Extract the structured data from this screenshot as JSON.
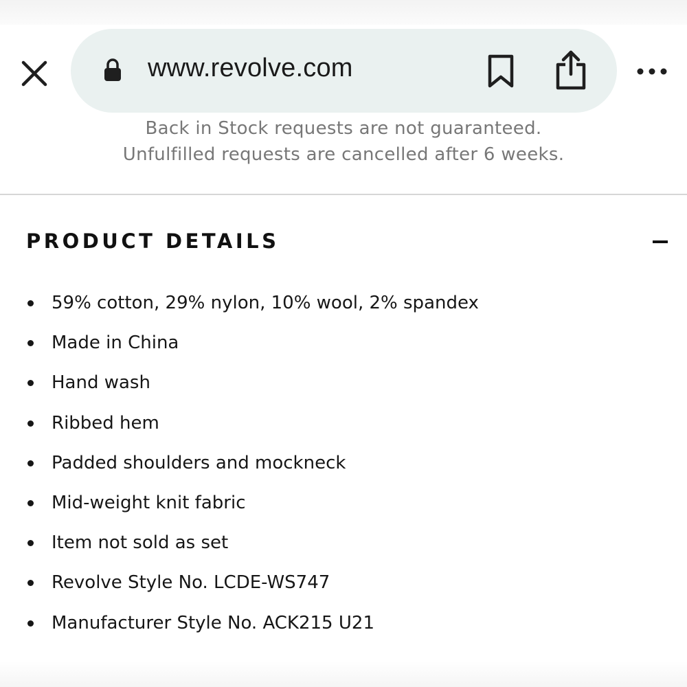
{
  "browser": {
    "url": "www.revolve.com",
    "icons": {
      "close": "close-icon",
      "lock": "lock-icon",
      "bookmark": "bookmark-icon",
      "share": "share-icon",
      "more": "more-options-icon"
    },
    "colors": {
      "url_pill": "#eaf1f0",
      "icon": "#1f1f1f"
    }
  },
  "notice": {
    "line1": "Back in Stock requests are not guaranteed.",
    "line2": "Unfulfilled requests are cancelled after 6 weeks."
  },
  "product_details": {
    "title": "PRODUCT DETAILS",
    "toggle_icon": "collapse-minus-icon",
    "items": [
      "59% cotton, 29% nylon, 10% wool, 2% spandex",
      "Made in China",
      "Hand wash",
      "Ribbed hem",
      "Padded shoulders and mockneck",
      "Mid-weight knit fabric",
      "Item not sold as set",
      "Revolve Style No. LCDE-WS747",
      "Manufacturer Style No. ACK215 U21"
    ]
  }
}
